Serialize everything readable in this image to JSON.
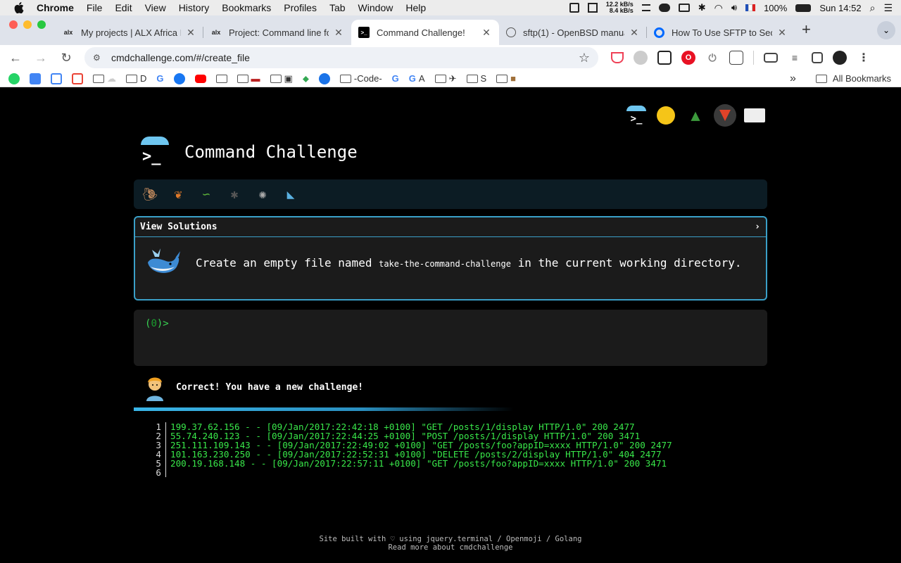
{
  "menubar": {
    "items": [
      "Chrome",
      "File",
      "Edit",
      "View",
      "History",
      "Bookmarks",
      "Profiles",
      "Tab",
      "Window",
      "Help"
    ],
    "net_up": "12.2 kB/s",
    "net_down": "8.4 kB/s",
    "battery": "100%",
    "clock": "Sun 14:52"
  },
  "tabs": [
    {
      "title": "My projects | ALX Africa Intranet",
      "favicon": "alx",
      "active": false
    },
    {
      "title": "Project: Command line for",
      "favicon": "alx",
      "active": false
    },
    {
      "title": "Command Challenge!",
      "favicon": "terminal",
      "active": true
    },
    {
      "title": "sftp(1) - OpenBSD manual",
      "favicon": "globe",
      "active": false
    },
    {
      "title": "How To Use SFTP to Secu",
      "favicon": "do",
      "active": false
    }
  ],
  "toolbar": {
    "url": "cmdchallenge.com/#/create_file"
  },
  "bookmarks": {
    "items": [
      "D",
      "S",
      "A",
      "-Code-"
    ],
    "all_bookmarks": "All Bookmarks"
  },
  "page": {
    "title": "Command Challenge",
    "view_solutions": "View Solutions",
    "task_prefix": "Create an empty file named",
    "task_filename": "take-the-command-challenge",
    "task_suffix": "in the current working directory.",
    "prompt_open": "(",
    "prompt_count": "0",
    "prompt_close": ")>",
    "result_message": "Correct! You have a new challenge!",
    "file_lines": [
      {
        "n": "1",
        "text": "199.37.62.156 - - [09/Jan/2017:22:42:18 +0100] \"GET /posts/1/display HTTP/1.0\" 200 2477"
      },
      {
        "n": "2",
        "text": "55.74.240.123 - - [09/Jan/2017:22:44:25 +0100] \"POST /posts/1/display HTTP/1.0\" 200 3471"
      },
      {
        "n": "3",
        "text": "251.111.109.143 - - [09/Jan/2017:22:49:02 +0100] \"GET /posts/foo?appID=xxxx HTTP/1.0\" 200 2477"
      },
      {
        "n": "4",
        "text": "101.163.230.250 - - [09/Jan/2017:22:52:31 +0100] \"DELETE /posts/2/display HTTP/1.0\" 404 2477"
      },
      {
        "n": "5",
        "text": "200.19.168.148 - - [09/Jan/2017:22:57:11 +0100] \"GET /posts/foo?appID=xxxx HTTP/1.0\" 200 3471"
      },
      {
        "n": "6",
        "text": ""
      }
    ],
    "footer_line1": "Site built with ♡ using jquery.terminal / Openmoji / Golang",
    "footer_line2": "Read more about cmdchallenge"
  }
}
